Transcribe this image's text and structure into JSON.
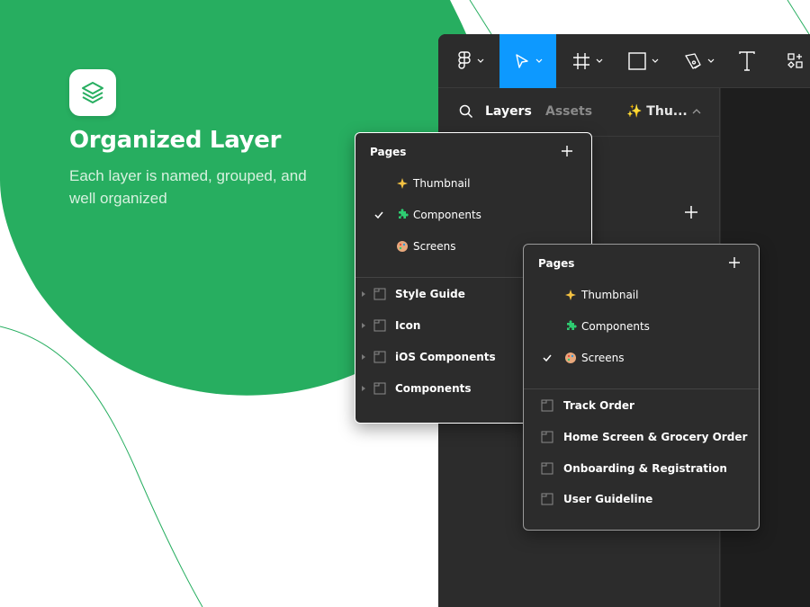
{
  "hero": {
    "title": "Organized Layer",
    "description": "Each layer is named, grouped, and well organized",
    "logo_icon": "layers-icon"
  },
  "colors": {
    "brand_green": "#27ae60",
    "figma_dark": "#2c2c2c",
    "canvas_dark": "#1e1e1e",
    "active_tool": "#0d99ff"
  },
  "toolbar": {
    "tools": [
      "figma-menu-icon",
      "move-tool-icon",
      "frame-tool-icon",
      "shape-tool-icon",
      "pen-tool-icon",
      "text-tool-icon",
      "resources-icon"
    ]
  },
  "sidebar": {
    "tabs": [
      {
        "label": "Layers"
      },
      {
        "label": "Assets"
      }
    ],
    "current_page": "✨ Thu..."
  },
  "popup_a": {
    "header": "Pages",
    "pages": [
      {
        "emoji": "sparkles",
        "label": "Thumbnail",
        "checked": false
      },
      {
        "emoji": "puzzle",
        "label": "Components",
        "checked": true
      },
      {
        "emoji": "palette",
        "label": "Screens",
        "checked": false
      }
    ],
    "frames": [
      {
        "label": "Style Guide"
      },
      {
        "label": "Icon"
      },
      {
        "label": "iOS Components"
      },
      {
        "label": "Components"
      }
    ]
  },
  "popup_b": {
    "header": "Pages",
    "pages": [
      {
        "emoji": "sparkles",
        "label": "Thumbnail",
        "checked": false
      },
      {
        "emoji": "puzzle",
        "label": "Components",
        "checked": false
      },
      {
        "emoji": "palette",
        "label": "Screens",
        "checked": true
      }
    ],
    "frames": [
      {
        "label": "Track Order"
      },
      {
        "label": "Home Screen & Grocery Order"
      },
      {
        "label": "Onboarding & Registration"
      },
      {
        "label": "User Guideline"
      }
    ]
  }
}
